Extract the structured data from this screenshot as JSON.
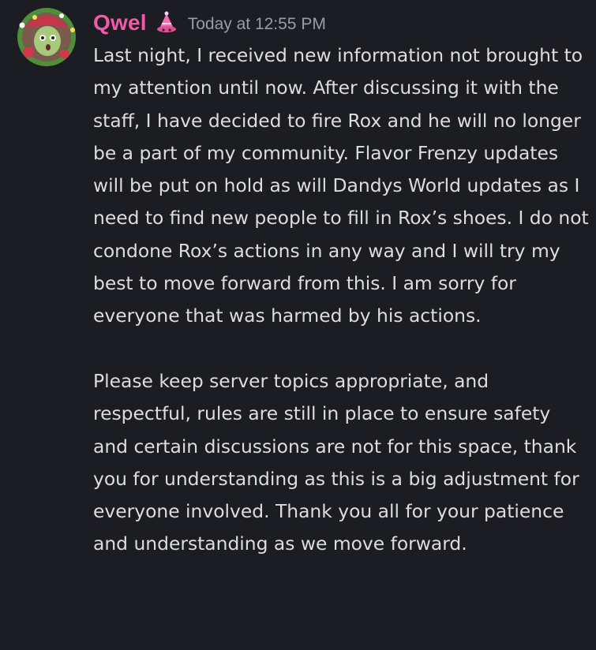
{
  "message": {
    "username": "Qwel",
    "timestamp": "Today at 12:55 PM",
    "avatar_icon": "strawberry-avatar-icon",
    "role_icon": "pink-hat-role-icon",
    "colors": {
      "username": "#f15aa8",
      "background": "#1c1d22",
      "text": "#dcdde1",
      "timestamp": "#9a9ca3"
    },
    "paragraph_1": "Last night, I received new information not brought to my attention until now. After discussing it with the staff, I have decided to fire Rox and he will no longer be a part of my community. Flavor Frenzy updates will be put on hold as will Dandys World updates as I need to find new people to fill in Rox’s shoes. I do not condone Rox’s actions in any way and I will try my best to move forward from this. I am sorry for everyone that was harmed by his actions.",
    "paragraph_2": "Please keep server topics appropriate, and respectful, rules are still in place to ensure safety and certain discussions are not for this space, thank you for understanding as this is a big adjustment for everyone involved. Thank you all for your patience and understanding as we move forward."
  }
}
